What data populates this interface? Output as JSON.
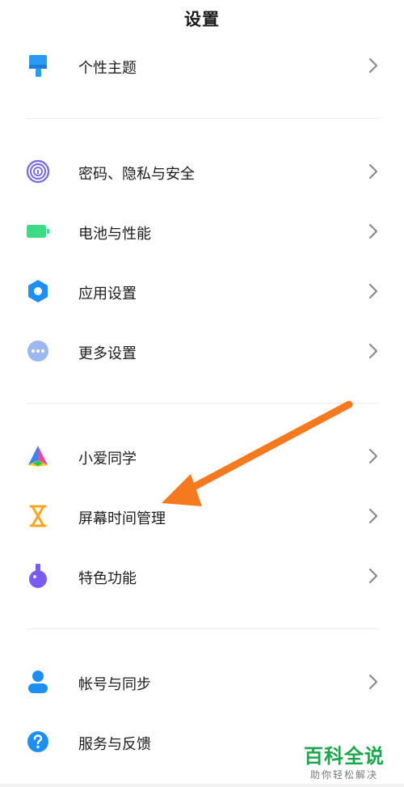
{
  "header": {
    "title": "设置"
  },
  "groups": [
    {
      "items": [
        {
          "label": "个性主题",
          "icon": "paintbrush-icon"
        }
      ]
    },
    {
      "items": [
        {
          "label": "密码、隐私与安全",
          "icon": "fingerprint-icon"
        },
        {
          "label": "电池与性能",
          "icon": "battery-icon"
        },
        {
          "label": "应用设置",
          "icon": "gear-icon"
        },
        {
          "label": "更多设置",
          "icon": "more-dots-icon"
        }
      ]
    },
    {
      "items": [
        {
          "label": "小爱同学",
          "icon": "xiaoai-icon"
        },
        {
          "label": "屏幕时间管理",
          "icon": "hourglass-icon"
        },
        {
          "label": "特色功能",
          "icon": "flask-icon"
        }
      ]
    },
    {
      "items": [
        {
          "label": "帐号与同步",
          "icon": "person-icon"
        },
        {
          "label": "服务与反馈",
          "icon": "help-icon"
        }
      ]
    }
  ],
  "watermark": {
    "main": "百科全说",
    "sub": "助你轻松解决"
  },
  "colors": {
    "theme_blue": "#2b9af3",
    "battery_green": "#3ddc84",
    "settings_blue": "#1e8ef0",
    "dots_blue": "#9cb8ee",
    "hourglass_orange": "#f5a623",
    "flask_purple": "#7a5cf5",
    "arrow_orange": "#f57a1f",
    "watermark_green": "#1aa64a"
  }
}
